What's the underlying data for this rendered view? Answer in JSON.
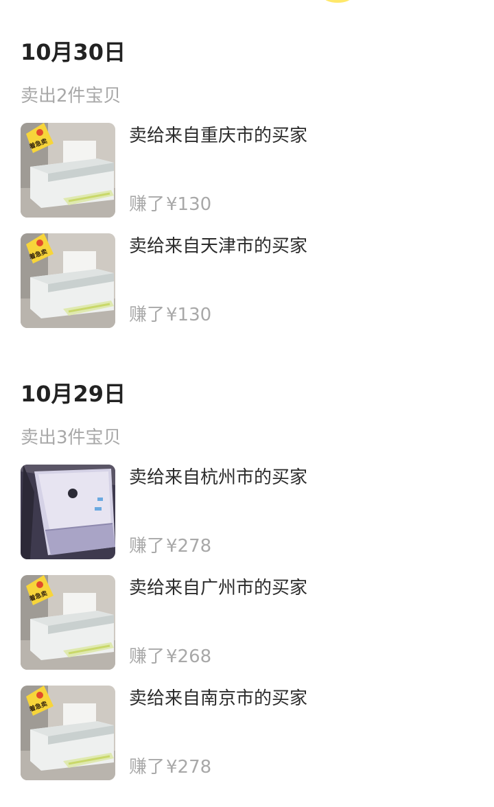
{
  "groups": [
    {
      "date": "10月30日",
      "sold_count": "卖出2件宝贝",
      "items": [
        {
          "buyer": "卖给来自重庆市的买家",
          "earned_prefix": "赚了",
          "amount": "¥130",
          "thumb": "printer-badge-photo"
        },
        {
          "buyer": "卖给来自天津市的买家",
          "earned_prefix": "赚了",
          "amount": "¥130",
          "thumb": "printer-badge-photo"
        }
      ]
    },
    {
      "date": "10月29日",
      "sold_count": "卖出3件宝贝",
      "items": [
        {
          "buyer": "卖给来自杭州市的买家",
          "earned_prefix": "赚了",
          "amount": "¥278",
          "thumb": "printer-closeup-photo"
        },
        {
          "buyer": "卖给来自广州市的买家",
          "earned_prefix": "赚了",
          "amount": "¥268",
          "thumb": "printer-badge-photo"
        },
        {
          "buyer": "卖给来自南京市的买家",
          "earned_prefix": "赚了",
          "amount": "¥278",
          "thumb": "printer-badge-photo"
        }
      ]
    }
  ],
  "badge_text": "着急卖",
  "colors": {
    "heading": "#222222",
    "secondary_text": "#a8a8a8",
    "badge": "#f7d53a",
    "top_indicator": "#ffe86a"
  }
}
